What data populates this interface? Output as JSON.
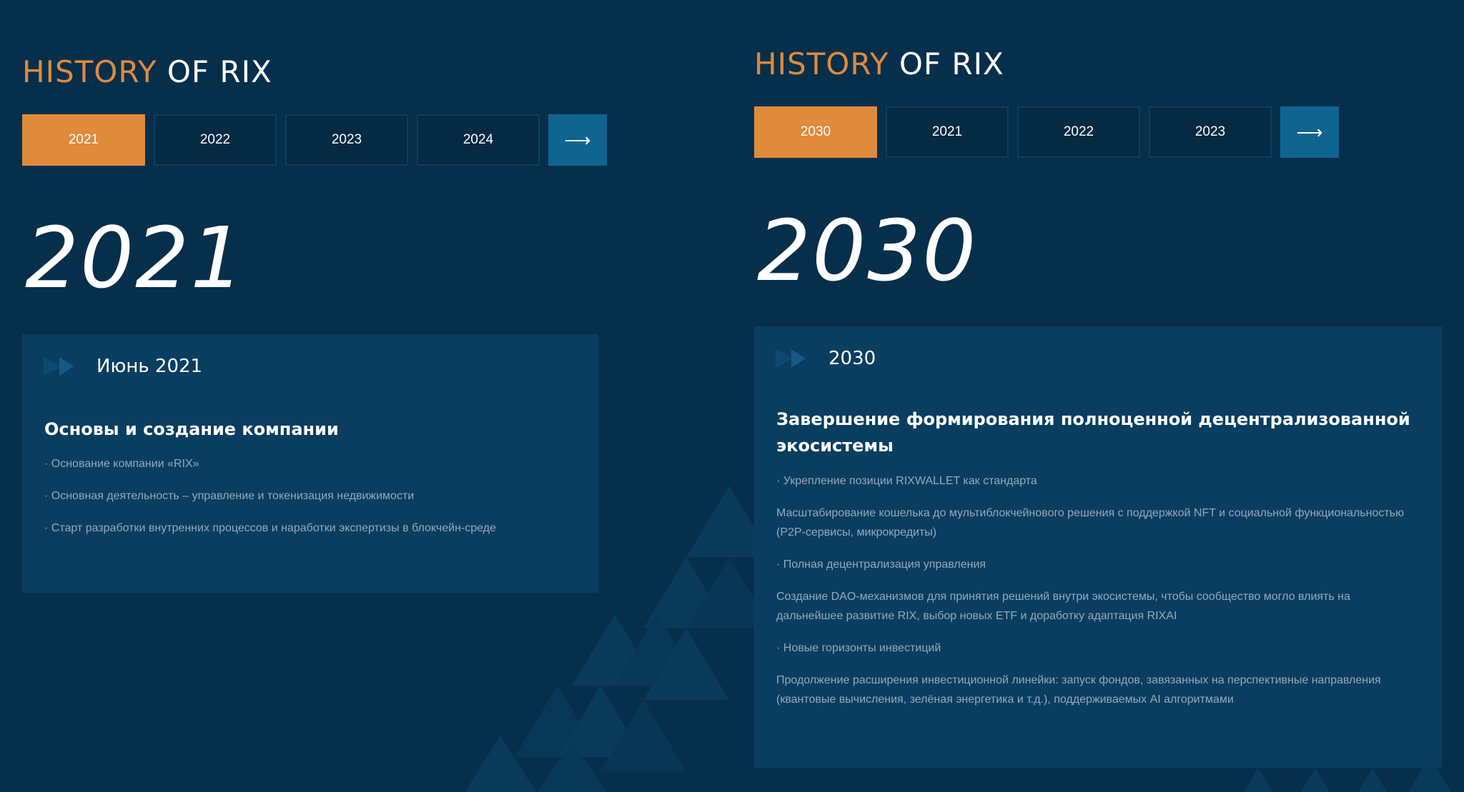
{
  "left": {
    "title_accent": "HISTORY",
    "title_rest": "OF RIX",
    "tabs": [
      "2021",
      "2022",
      "2023",
      "2024"
    ],
    "active_tab": "2021",
    "next_arrow": "⟶",
    "big_year": "2021",
    "card": {
      "date": "Июнь 2021",
      "title": "Основы и создание компании",
      "items": [
        "· Основание компании «RIX»",
        "· Основная деятельность – управление и токенизация недвижимости",
        "· Старт разработки внутренних процессов и наработки экспертизы в блокчейн-среде"
      ]
    }
  },
  "right": {
    "title_accent": "HISTORY",
    "title_rest": "OF RIX",
    "tabs": [
      "2030",
      "2021",
      "2022",
      "2023"
    ],
    "active_tab": "2030",
    "next_arrow": "⟶",
    "big_year": "2030",
    "card": {
      "date": "2030",
      "title": "Завершение формирования полноценной децентрализованной экосистемы",
      "items": [
        "· Укрепление позиции RIXWALLET как стандарта",
        "Масштабирование кошелька до мультиблокчейнового решения с поддержкой NFT и социальной функциональностью (P2P-сервисы, микрокредиты)",
        "· Полная децентрализация управления",
        "Создание DAO-механизмов для принятия решений внутри экосистемы, чтобы сообщество могло влиять на дальнейшее развитие RIX, выбор новых ETF и доработку адаптация RIXAI",
        "· Новые горизонты инвестиций",
        "Продолжение расширения инвестиционной линейки: запуск фондов, завязанных на перспективные направления (квантовые вычисления, зелёная энергетика и т.д.), поддерживаемых AI алгоритмами"
      ]
    }
  },
  "colors": {
    "background": "#062f4c",
    "accent": "#e08a3c",
    "card": "#0a3e61",
    "next_button": "#0f6590"
  }
}
